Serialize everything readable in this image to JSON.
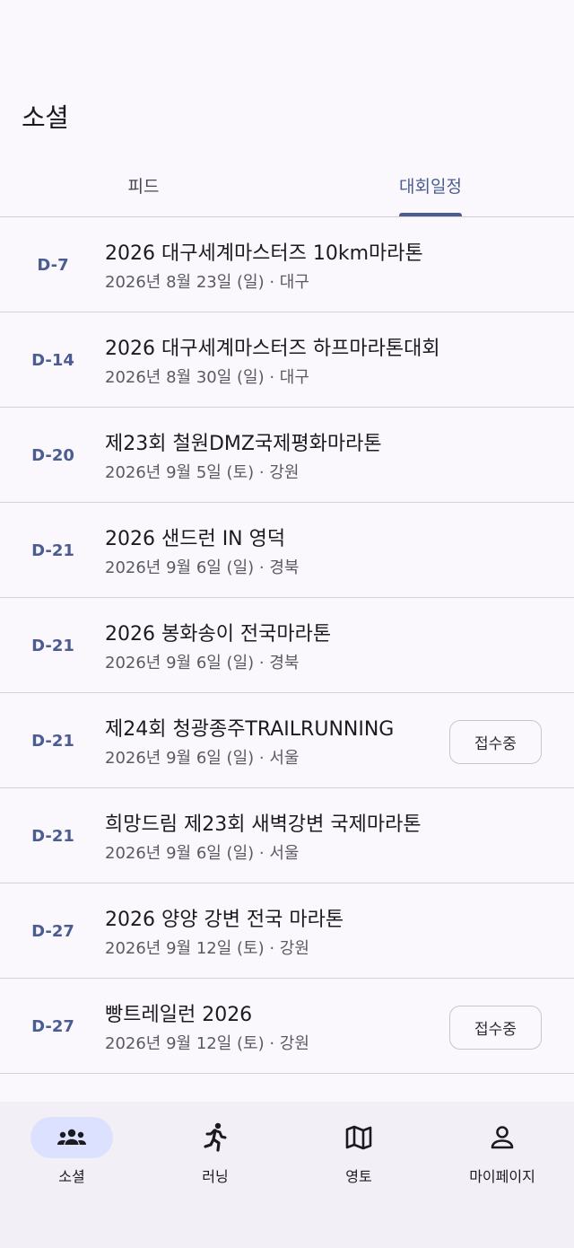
{
  "header": {
    "title": "소셜"
  },
  "tabs": [
    {
      "label": "피드",
      "active": false
    },
    {
      "label": "대회일정",
      "active": true
    }
  ],
  "events": [
    {
      "dday": "D-7",
      "name": "2026 대구세계마스터즈 10km마라톤",
      "date": "2026년 8월 23일 (일) · 대구",
      "button": ""
    },
    {
      "dday": "D-14",
      "name": "2026 대구세계마스터즈 하프마라톤대회",
      "date": "2026년 8월 30일 (일) · 대구",
      "button": ""
    },
    {
      "dday": "D-20",
      "name": "제23회 철원DMZ국제평화마라톤",
      "date": "2026년 9월 5일 (토) · 강원",
      "button": ""
    },
    {
      "dday": "D-21",
      "name": "2026 샌드런 IN 영덕",
      "date": "2026년 9월 6일 (일) · 경북",
      "button": ""
    },
    {
      "dday": "D-21",
      "name": "2026 봉화송이 전국마라톤",
      "date": "2026년 9월 6일 (일) · 경북",
      "button": ""
    },
    {
      "dday": "D-21",
      "name": "제24회 청광종주TRAILRUNNING",
      "date": "2026년 9월 6일 (일) · 서울",
      "button": "접수중"
    },
    {
      "dday": "D-21",
      "name": "희망드림 제23회 새벽강변 국제마라톤",
      "date": "2026년 9월 6일 (일) · 서울",
      "button": ""
    },
    {
      "dday": "D-27",
      "name": "2026 양양 강변 전국 마라톤",
      "date": "2026년 9월 12일 (토) · 강원",
      "button": ""
    },
    {
      "dday": "D-27",
      "name": "빵트레일런 2026",
      "date": "2026년 9월 12일 (토) · 강원",
      "button": "접수중"
    }
  ],
  "bottom_nav": [
    {
      "label": "소셜",
      "icon": "people-icon",
      "active": true
    },
    {
      "label": "러닝",
      "icon": "running-icon",
      "active": false
    },
    {
      "label": "영토",
      "icon": "map-icon",
      "active": false
    },
    {
      "label": "마이페이지",
      "icon": "person-icon",
      "active": false
    }
  ],
  "colors": {
    "accent": "#4a5c92",
    "active_pill": "#dbe1ff",
    "background": "#fbf8fd",
    "nav_background": "#f2eff6"
  }
}
